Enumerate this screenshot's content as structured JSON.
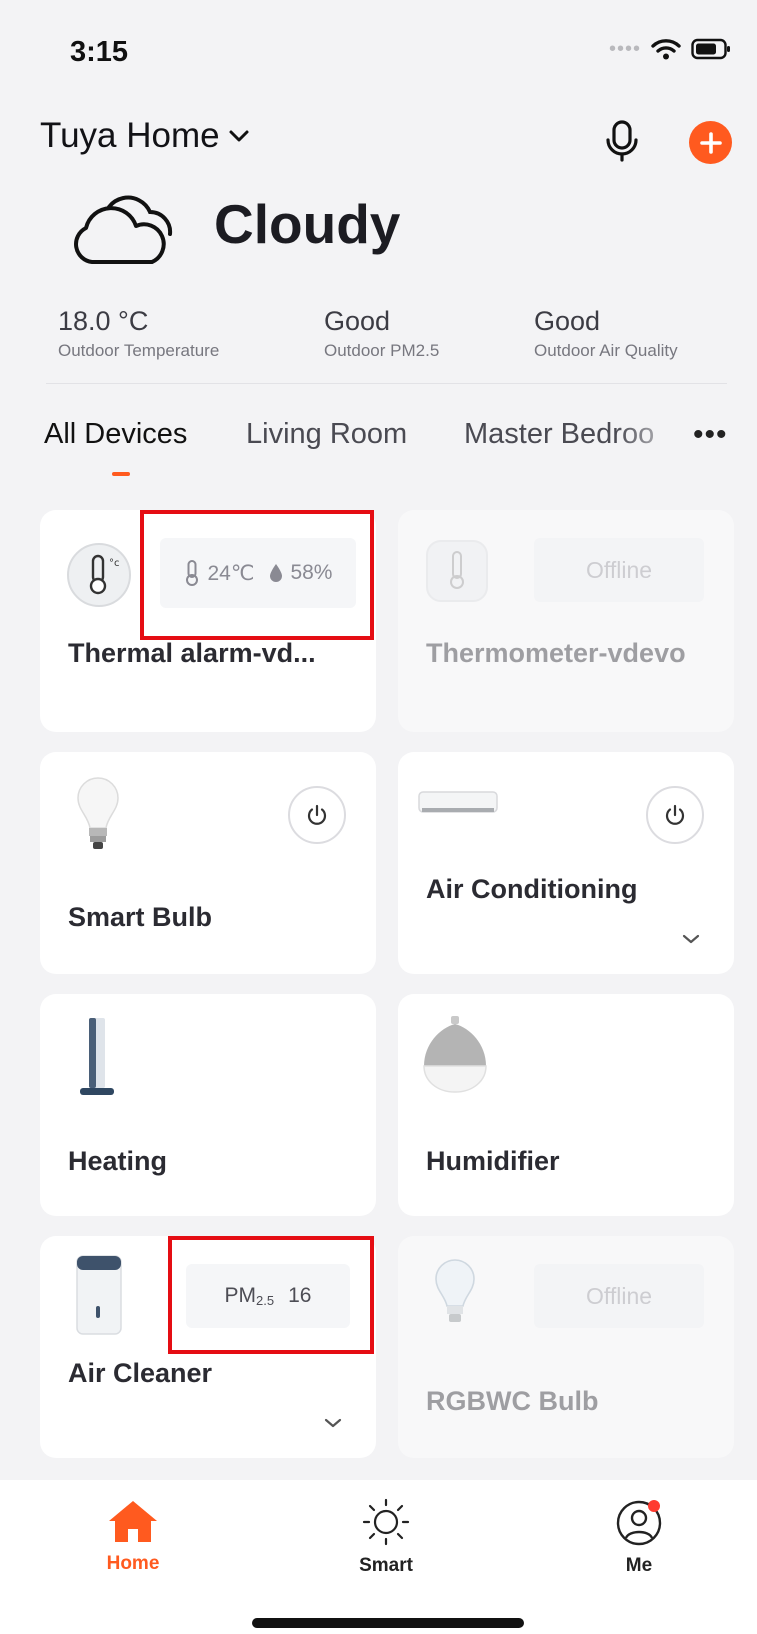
{
  "status_bar": {
    "time": "3:15"
  },
  "header": {
    "home_name": "Tuya Home"
  },
  "weather": {
    "condition": "Cloudy",
    "stats": [
      {
        "value": "18.0 °C",
        "label": "Outdoor Temperature"
      },
      {
        "value": "Good",
        "label": "Outdoor PM2.5"
      },
      {
        "value": "Good",
        "label": "Outdoor Air Quality"
      }
    ]
  },
  "tabs": [
    {
      "label": "All Devices",
      "active": true
    },
    {
      "label": "Living Room",
      "active": false
    },
    {
      "label": "Master Bedroo",
      "active": false
    }
  ],
  "devices": [
    {
      "name": "Thermal alarm-vd...",
      "temperature": "24℃",
      "humidity": "58%",
      "online": true
    },
    {
      "name": "Thermometer-vdevo",
      "status": "Offline",
      "online": false
    },
    {
      "name": "Smart Bulb",
      "online": true
    },
    {
      "name": "Air Conditioning",
      "online": true
    },
    {
      "name": "Heating",
      "online": true
    },
    {
      "name": "Humidifier",
      "online": true
    },
    {
      "name": "Air Cleaner",
      "pm_label": "PM",
      "pm_sub": "2.5",
      "pm_value": "16",
      "online": true
    },
    {
      "name": "RGBWC Bulb",
      "status": "Offline",
      "online": false
    }
  ],
  "bottom_nav": [
    {
      "label": "Home",
      "active": true,
      "icon": "home-icon"
    },
    {
      "label": "Smart",
      "active": false,
      "icon": "sun-icon"
    },
    {
      "label": "Me",
      "active": false,
      "icon": "user-icon",
      "badge": true
    }
  ],
  "colors": {
    "accent": "#ff5a1f",
    "highlight": "#e50d13",
    "background": "#f3f3f5"
  }
}
